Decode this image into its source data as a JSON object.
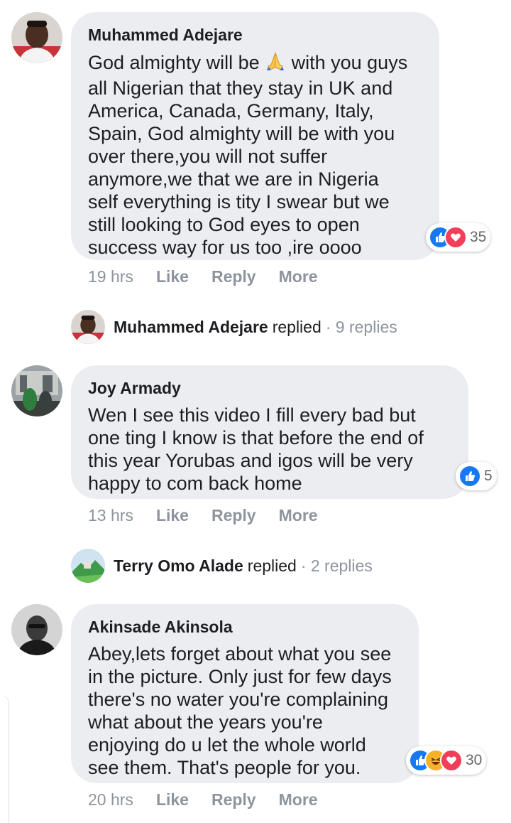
{
  "comments": [
    {
      "author": "Muhammed Adejare",
      "text_before_emoji": "God almighty will be ",
      "emoji": "folded-hands",
      "text_after_emoji": " with you guys\nall Nigerian that they stay in UK and\nAmerica, Canada, Germany, Italy,\nSpain, God almighty will be with you\nover there,you will not suffer\nanymore,we that we are in Nigeria\nself everything is tity I swear but we\nstill looking to God eyes to open\nsuccess way for us too ,ire oooo",
      "reactions": [
        "like",
        "love"
      ],
      "reaction_count": "35",
      "time": "19 hrs",
      "like_label": "Like",
      "reply_label": "Reply",
      "more_label": "More",
      "replies": {
        "name": "Muhammed Adejare",
        "verb": "replied",
        "count": "· 9 replies"
      }
    },
    {
      "author": "Joy Armady",
      "text": "Wen I see this video I fill every bad but\none ting I know is that before the end of\nthis year Yorubas and igos will be very\nhappy to com back home",
      "reactions": [
        "like"
      ],
      "reaction_count": "5",
      "time": "13 hrs",
      "like_label": "Like",
      "reply_label": "Reply",
      "more_label": "More",
      "replies": {
        "name": "Terry Omo Alade",
        "verb": "replied",
        "count": "· 2 replies"
      }
    },
    {
      "author": "Akinsade Akinsola",
      "text": "Abey,lets forget about what you see\nin the picture. Only just for few days\nthere's no water you're complaining\nwhat about the years you're\nenjoying do u let the whole world\nsee them. That's people for you.",
      "reactions": [
        "like",
        "haha",
        "love"
      ],
      "reaction_count": "30",
      "time": "20 hrs",
      "like_label": "Like",
      "reply_label": "Reply",
      "more_label": "More"
    }
  ],
  "colors": {
    "bubble": "#ebedf0",
    "like": "#1877f2",
    "love": "#f33e58",
    "haha": "#f7b125",
    "muted": "#8d949e"
  }
}
